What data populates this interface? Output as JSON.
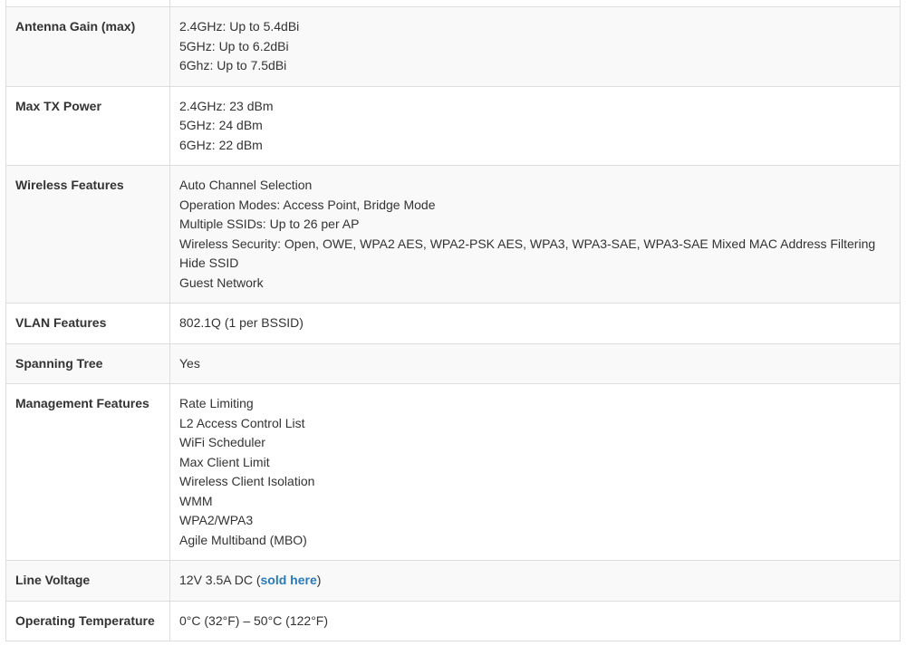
{
  "spec_table": {
    "rows": [
      {
        "label": "",
        "lines": [
          ""
        ]
      },
      {
        "label": "Antenna Gain (max)",
        "lines": [
          "2.4GHz: Up to 5.4dBi",
          "5GHz: Up to 6.2dBi",
          "6Ghz: Up to 7.5dBi"
        ]
      },
      {
        "label": "Max TX Power",
        "lines": [
          "2.4GHz: 23 dBm",
          "5GHz: 24 dBm",
          "6GHz: 22 dBm"
        ]
      },
      {
        "label": "Wireless Features",
        "lines": [
          "Auto Channel Selection",
          "Operation Modes: Access Point, Bridge Mode",
          "Multiple SSIDs: Up to 26 per AP",
          "Wireless Security: Open, OWE, WPA2 AES, WPA2-PSK AES, WPA3, WPA3-SAE, WPA3-SAE Mixed MAC Address Filtering",
          "Hide SSID",
          "Guest Network"
        ]
      },
      {
        "label": "VLAN Features",
        "lines": [
          "802.1Q (1 per BSSID)"
        ]
      },
      {
        "label": "Spanning Tree",
        "lines": [
          "Yes"
        ]
      },
      {
        "label": "Management Features",
        "lines": [
          "Rate Limiting",
          "L2 Access Control List",
          "WiFi Scheduler",
          "Max Client Limit",
          "Wireless Client Isolation",
          "WMM",
          "WPA2/WPA3",
          "Agile Multiband (MBO)"
        ]
      },
      {
        "label": "Line Voltage",
        "value_prefix": "12V 3.5A DC (",
        "link_text": "sold here",
        "value_suffix": ")"
      },
      {
        "label": "Operating Temperature",
        "lines": [
          "0°C (32°F) – 50°C (122°F)"
        ]
      }
    ]
  }
}
